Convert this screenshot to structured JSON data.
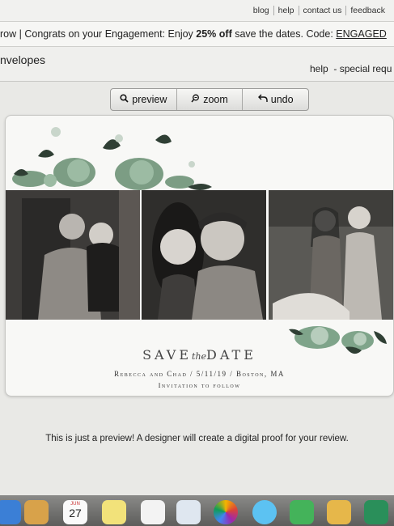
{
  "top_links": [
    "blog",
    "help",
    "contact us",
    "feedback"
  ],
  "promo": {
    "prefix": "row | Congrats on your Engagement: Enjoy ",
    "discount": "25% off",
    "middle": " save the dates. Code: ",
    "code": "ENGAGED"
  },
  "section": {
    "title": "nvelopes",
    "help": "help",
    "special": "- special requ"
  },
  "toolbar": {
    "preview": "preview",
    "zoom": "zoom",
    "undo": "undo"
  },
  "card": {
    "save_left": "SAVE",
    "save_script": "the",
    "save_right": "DATE",
    "names_line": "Rebecca and Chad / 5/11/19 / Boston, MA",
    "invite_line": "Invitation to follow"
  },
  "preview_note": "This is just a preview! A designer will create a digital proof for your review.",
  "dock": {
    "calendar_month": "JUN",
    "calendar_day": "27",
    "icons": [
      "finder-icon",
      "folder-icon",
      "calendar-icon",
      "notes-icon",
      "reminders-icon",
      "keynote-icon",
      "photos-icon",
      "messages-icon",
      "facetime-icon",
      "preview-icon",
      "numbers-icon"
    ]
  },
  "colors": {
    "floral_green": "#5f8a6a",
    "floral_dark": "#2f3f34",
    "card_background": "#f8f8f6",
    "text_gray": "#444444"
  }
}
